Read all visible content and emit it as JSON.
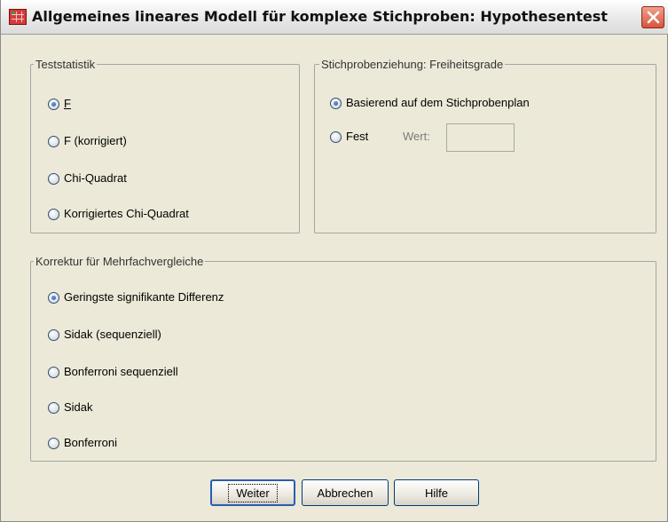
{
  "window": {
    "title": "Allgemeines lineares Modell für komplexe Stichproben: Hypothesentest",
    "icon": "spss-table-icon",
    "close_icon": "close-icon"
  },
  "teststatistik": {
    "legend": "Teststatistik",
    "options": [
      {
        "label": "F",
        "checked": true
      },
      {
        "label": "F (korrigiert)",
        "checked": false
      },
      {
        "label": "Chi-Quadrat",
        "checked": false
      },
      {
        "label": "Korrigiertes Chi-Quadrat",
        "checked": false
      }
    ]
  },
  "freiheitsgrade": {
    "legend": "Stichprobenziehung: Freiheitsgrade",
    "options": [
      {
        "label": "Basierend auf dem Stichprobenplan",
        "checked": true
      },
      {
        "label": "Fest",
        "checked": false
      }
    ],
    "wert_label": "Wert:",
    "wert_value": ""
  },
  "korrektur": {
    "legend": "Korrektur für Mehrfachvergleiche",
    "options": [
      {
        "label": "Geringste signifikante Differenz",
        "checked": true
      },
      {
        "label": "Sidak (sequenziell)",
        "checked": false
      },
      {
        "label": "Bonferroni sequenziell",
        "checked": false
      },
      {
        "label": "Sidak",
        "checked": false
      },
      {
        "label": "Bonferroni",
        "checked": false
      }
    ]
  },
  "buttons": {
    "weiter": "Weiter",
    "abbrechen": "Abbrechen",
    "hilfe": "Hilfe"
  }
}
